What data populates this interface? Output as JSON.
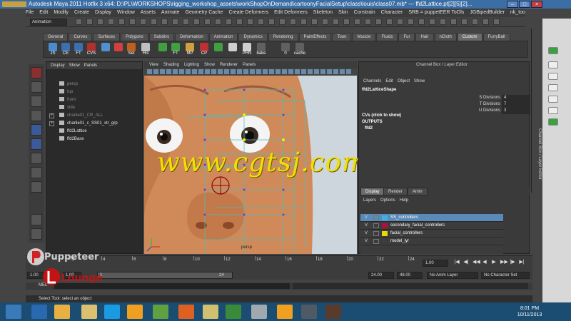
{
  "window": {
    "title": "Autodesk Maya 2011 Hotfix 3 x64: D:\\PL\\WORKSHOPS\\rigging_workshop_assets\\workShopOnDemand\\cartoonyFacialSetup\\class\\louis\\class07.mb*  ---  ffd2Lattice.pt[2][5][2]..."
  },
  "menubar": {
    "items": [
      "File",
      "Edit",
      "Modify",
      "Create",
      "Display",
      "Window",
      "Assets",
      "Animate",
      "Geometry Cache",
      "Create Deformers",
      "Edit Deformers",
      "Skeleton",
      "Skin",
      "Constrain",
      "Character",
      "SRB = puppetEER ToOls",
      "JGBipedBuilder",
      "nk_tools",
      "Help"
    ]
  },
  "statusline": {
    "mode": "Animation"
  },
  "shelf": {
    "tabs": [
      "General",
      "Curves",
      "Surfaces",
      "Polygons",
      "Subdivs",
      "Deformation",
      "Animation",
      "Dynamics",
      "Rendering",
      "PaintEffects",
      "Toon",
      "Muscle",
      "Fluids",
      "Fur",
      "Hair",
      "nCloth",
      "Custom",
      "FurryBall"
    ],
    "active_tab": "Custom",
    "buttons": [
      {
        "label": "JS",
        "color": "#4a8ad0"
      },
      {
        "label": "CE",
        "color": "#3a70b0"
      },
      {
        "label": "FT",
        "color": "#3a70b0"
      },
      {
        "label": "CVS",
        "color": "#b03030"
      },
      {
        "label": "",
        "color": "#5090d0"
      },
      {
        "label": "",
        "color": "#d04040"
      },
      {
        "label": "Set",
        "color": "#c06020"
      },
      {
        "label": "His",
        "color": "#c0c0c0"
      },
      {
        "label": "",
        "color": "#40a040"
      },
      {
        "label": "FT",
        "color": "#40a040"
      },
      {
        "label": "MP",
        "color": "#d0a040"
      },
      {
        "label": "CP",
        "color": "#c03030"
      },
      {
        "label": "",
        "color": "#40a040"
      },
      {
        "label": "",
        "color": "#d0d0d0"
      },
      {
        "label": "PHN",
        "color": "#d0d0d0"
      },
      {
        "label": "bake",
        "color": "#606060"
      },
      {
        "label": "0",
        "color": "#606060"
      },
      {
        "label": "cache",
        "color": "#606060"
      }
    ]
  },
  "outliner": {
    "menu": [
      "Display",
      "Show",
      "Panels"
    ],
    "items": [
      {
        "label": "persp",
        "dim": true,
        "expand": false
      },
      {
        "label": "top",
        "dim": true,
        "expand": false
      },
      {
        "label": "front",
        "dim": true,
        "expand": false
      },
      {
        "label": "side",
        "dim": true,
        "expand": false
      },
      {
        "label": "charlie01_CR_ALL",
        "dim": true,
        "expand": true
      },
      {
        "label": "charlie01_c_SS01_xtr_grp",
        "dim": false,
        "expand": true
      },
      {
        "label": "ffd2Lattice",
        "dim": false,
        "expand": false
      },
      {
        "label": "ffd2Base",
        "dim": false,
        "expand": false
      }
    ]
  },
  "viewport": {
    "menu": [
      "View",
      "Shading",
      "Lighting",
      "Show",
      "Renderer",
      "Panels"
    ],
    "camera": "persp"
  },
  "watermark": "www.cgtsj.com",
  "channelbox": {
    "title": "Channel Box / Layer Editor",
    "menu": [
      "Channels",
      "Edit",
      "Object",
      "Show"
    ],
    "node": "ffd2LatticeShape",
    "attributes": [
      {
        "name": "S Divisions",
        "value": "4"
      },
      {
        "name": "T Divisions",
        "value": "7"
      },
      {
        "name": "U Divisions",
        "value": "3"
      }
    ],
    "cvs_label": "CVs (click to show)",
    "outputs_label": "OUTPUTS",
    "output_node": "ffd2"
  },
  "layer_editor": {
    "tabs": [
      "Display",
      "Render",
      "Anim"
    ],
    "active_tab": "Display",
    "menu": [
      "Layers",
      "Options",
      "Help"
    ],
    "layers": [
      {
        "v": "V",
        "name": "SS_controllers",
        "color": "#40b0e0",
        "selected": true
      },
      {
        "v": "V",
        "name": "secondary_facial_controllers",
        "color": "#b01040",
        "selected": false
      },
      {
        "v": "V",
        "name": "facial_controllers",
        "color": "#e8d800",
        "selected": false
      },
      {
        "v": "V",
        "name": "model_lyr",
        "color": "#3c3c3c",
        "selected": false
      }
    ]
  },
  "rightstrip": {
    "label": "Channel Box / Layer Editor"
  },
  "timeslider": {
    "ticks": [
      "2",
      "4",
      "6",
      "8",
      "10",
      "12",
      "14",
      "16",
      "18",
      "20",
      "22",
      "24"
    ],
    "current_frame": "1.00",
    "playback": [
      "|◀",
      "◀|",
      "◀◀",
      "◀",
      "▶",
      "▶▶",
      "|▶",
      "▶|"
    ]
  },
  "rangebar": {
    "start": "1.00",
    "start2": "1.00",
    "slider_start": "1",
    "slider_end": "24",
    "end": "24.00",
    "end2": "48.00",
    "anim_layer": "No Anim Layer",
    "character_set": "No Character Set"
  },
  "cmdline": {
    "label": "MEL"
  },
  "helpline": {
    "text": "Select Tool: select an object"
  },
  "logo": {
    "line1": "Puppeteer",
    "line2": "Lounge"
  },
  "taskbar": {
    "time": "8:01 PM",
    "date": "10/11/2013"
  }
}
